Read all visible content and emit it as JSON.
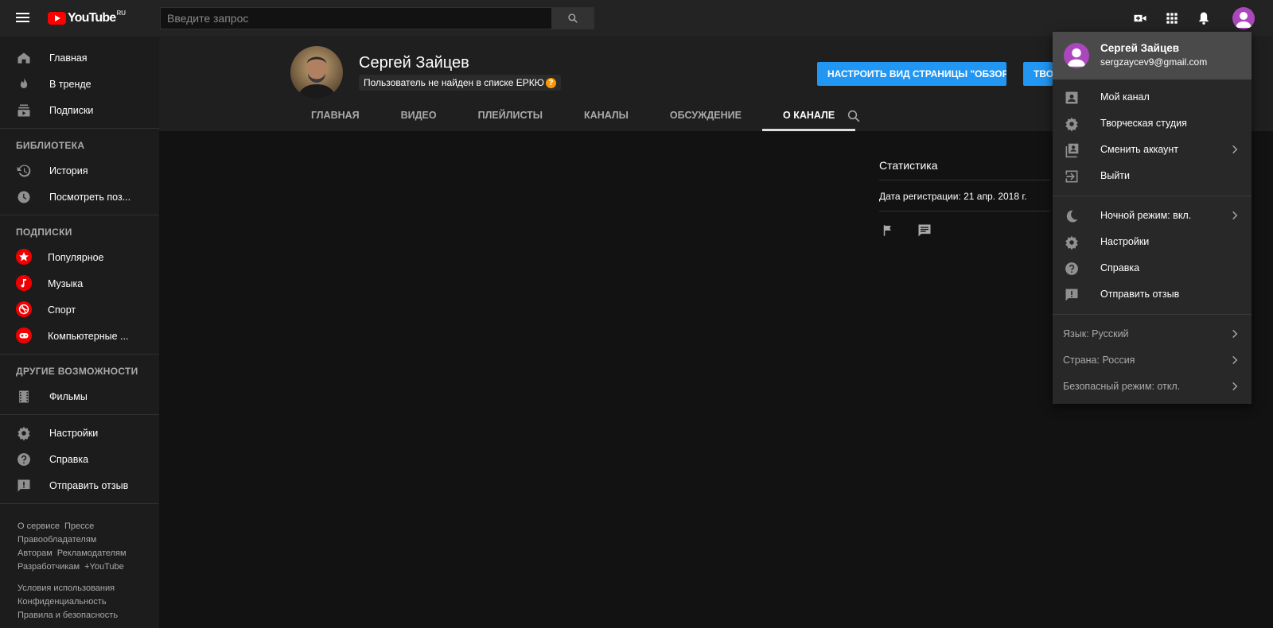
{
  "header": {
    "logo_text": "YouTube",
    "logo_region": "RU",
    "search_placeholder": "Введите запрос"
  },
  "sidebar": {
    "main": [
      {
        "label": "Главная",
        "icon": "home-icon"
      },
      {
        "label": "В тренде",
        "icon": "fire-icon"
      },
      {
        "label": "Подписки",
        "icon": "subscriptions-icon"
      }
    ],
    "library_title": "БИБЛИОТЕКА",
    "library": [
      {
        "label": "История",
        "icon": "history-icon"
      },
      {
        "label": "Посмотреть поз...",
        "icon": "clock-icon"
      }
    ],
    "subscriptions_title": "ПОДПИСКИ",
    "subscriptions": [
      {
        "label": "Популярное",
        "icon": "star-icon"
      },
      {
        "label": "Музыка",
        "icon": "music-icon"
      },
      {
        "label": "Спорт",
        "icon": "sport-icon"
      },
      {
        "label": "Компьютерные ...",
        "icon": "gamepad-icon"
      }
    ],
    "more_title": "ДРУГИЕ ВОЗМОЖНОСТИ",
    "more": [
      {
        "label": "Фильмы",
        "icon": "film-icon"
      }
    ],
    "settings": [
      {
        "label": "Настройки",
        "icon": "gear-icon"
      },
      {
        "label": "Справка",
        "icon": "help-icon"
      },
      {
        "label": "Отправить отзыв",
        "icon": "feedback-icon"
      }
    ],
    "footer": {
      "about": "О сервисе",
      "press": "Прессе",
      "copyright": "Правообладателям",
      "creators": "Авторам",
      "advertisers": "Рекламодателям",
      "developers": "Разработчикам",
      "plus": "+YouTube",
      "terms": "Условия использования",
      "privacy": "Конфиденциальность",
      "safety": "Правила и безопасность"
    }
  },
  "channel": {
    "name": "Сергей Зайцев",
    "badge": "Пользователь не найден в списке ЕРКЮ",
    "badge_icon": "?",
    "customize_button": "НАСТРОИТЬ ВИД СТРАНИЦЫ \"ОБЗОР\"",
    "studio_button": "ТВОРЧЕСКАЯ СТУДИЯ",
    "tabs": [
      "ГЛАВНАЯ",
      "ВИДЕО",
      "ПЛЕЙЛИСТЫ",
      "КАНАЛЫ",
      "ОБСУЖДЕНИЕ",
      "О КАНАЛЕ"
    ],
    "active_tab": "О КАНАЛЕ"
  },
  "stats": {
    "title": "Статистика",
    "registration": "Дата регистрации: 21 апр. 2018 г."
  },
  "account_menu": {
    "name": "Сергей Зайцев",
    "email": "sergzaycev9@gmail.com",
    "group1": [
      {
        "label": "Мой канал",
        "icon": "account-box-icon"
      },
      {
        "label": "Творческая студия",
        "icon": "gear-icon"
      },
      {
        "label": "Сменить аккаунт",
        "icon": "switch-account-icon"
      },
      {
        "label": "Выйти",
        "icon": "exit-icon"
      }
    ],
    "group2": [
      {
        "label": "Ночной режим: вкл.",
        "icon": "moon-icon"
      },
      {
        "label": "Настройки",
        "icon": "gear-icon"
      },
      {
        "label": "Справка",
        "icon": "help-icon"
      },
      {
        "label": "Отправить отзыв",
        "icon": "feedback-icon"
      }
    ],
    "group3": [
      {
        "label": "Язык: Русский"
      },
      {
        "label": "Страна: Россия"
      },
      {
        "label": "Безопасный режим: откл."
      }
    ]
  },
  "colors": {
    "accent_blue": "#2196f3",
    "brand_red": "#ff0000",
    "avatar_purple": "#ab47bc"
  }
}
